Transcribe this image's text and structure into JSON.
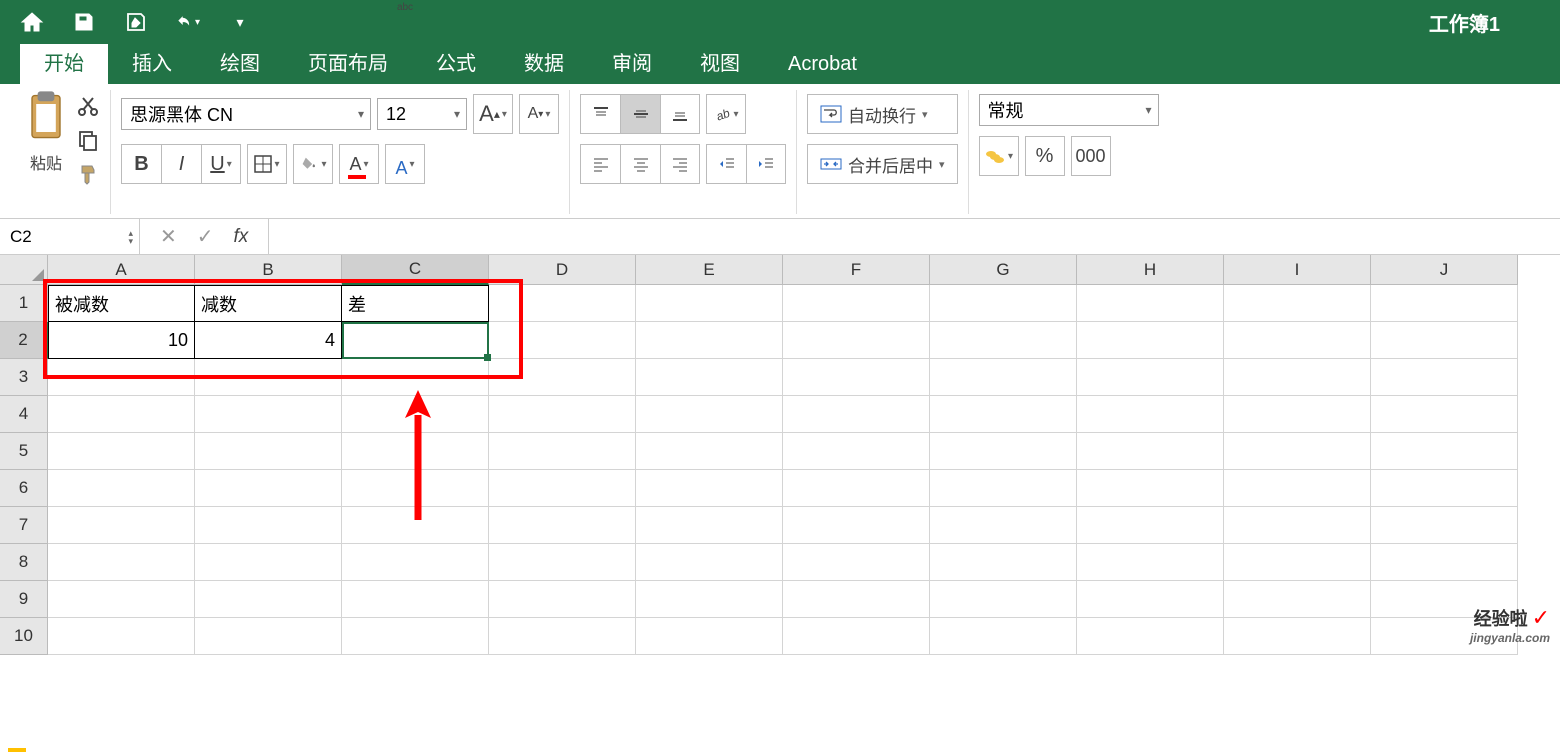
{
  "title": "工作簿1",
  "tabs": [
    "开始",
    "插入",
    "绘图",
    "页面布局",
    "公式",
    "数据",
    "审阅",
    "视图",
    "Acrobat"
  ],
  "active_tab": 0,
  "clipboard": {
    "paste_label": "粘贴"
  },
  "font": {
    "name": "思源黑体 CN",
    "size": "12"
  },
  "alignment": {
    "wrap_text": "自动换行",
    "merge_center": "合并后居中"
  },
  "number": {
    "format": "常规"
  },
  "name_box": "C2",
  "formula": "",
  "columns": [
    "A",
    "B",
    "C",
    "D",
    "E",
    "F",
    "G",
    "H",
    "I",
    "J"
  ],
  "rows": [
    "1",
    "2",
    "3",
    "4",
    "5",
    "6",
    "7",
    "8",
    "9",
    "10"
  ],
  "active_col": 2,
  "active_row": 1,
  "cell_data": {
    "r0": {
      "c0": "被减数",
      "c1": "减数",
      "c2": "差"
    },
    "r1": {
      "c0": "10",
      "c1": "4",
      "c2": ""
    }
  },
  "watermark": {
    "main": "经验啦",
    "sub": "jingyanla.com"
  }
}
